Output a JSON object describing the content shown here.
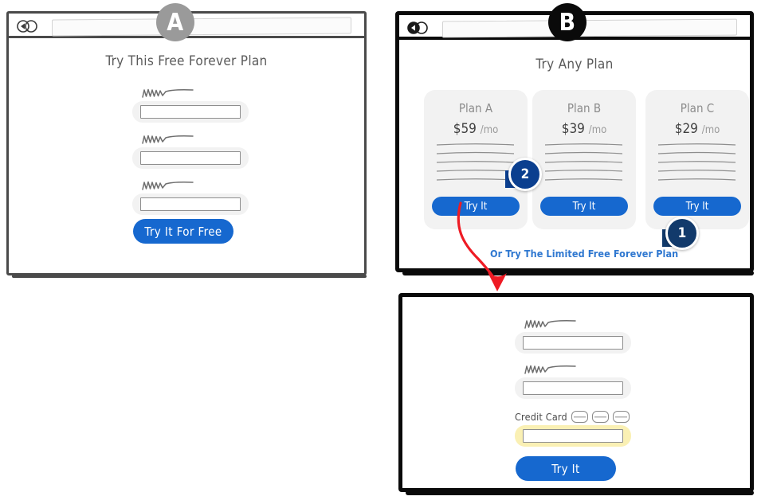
{
  "panel_a": {
    "marker_label": "A",
    "marker_color": "#9a9a9a",
    "browser": {
      "back_icon": "back-arrow-icon",
      "forward_icon": "forward-circle-icon",
      "url_value": ""
    },
    "title": "Try This Free Forever Plan",
    "fields": [
      {
        "label_icon": "scribble-label",
        "value": "",
        "placeholder": ""
      },
      {
        "label_icon": "scribble-label",
        "value": "",
        "placeholder": ""
      },
      {
        "label_icon": "scribble-label",
        "value": "",
        "placeholder": ""
      }
    ],
    "submit_label": "Try It For Free",
    "submit_color": "#1668cf"
  },
  "panel_b": {
    "marker_label": "B",
    "marker_color": "#0a0a0a",
    "browser": {
      "back_icon": "back-arrow-icon",
      "forward_icon": "forward-circle-icon",
      "url_value": ""
    },
    "title": "Try Any Plan",
    "plans": [
      {
        "name": "Plan A",
        "price": "$59",
        "period": "/mo",
        "feature_line_count": 5,
        "cta_label": "Try It"
      },
      {
        "name": "Plan B",
        "price": "$39",
        "period": "/mo",
        "feature_line_count": 5,
        "cta_label": "Try It"
      },
      {
        "name": "Plan C",
        "price": "$29",
        "period": "/mo",
        "feature_line_count": 5,
        "cta_label": "Try It"
      }
    ],
    "free_plan_link": "Or Try The Limited Free Forever Plan",
    "free_plan_link_color": "#2e77d0",
    "cta_color": "#1668cf",
    "badges": [
      {
        "number": "1",
        "color": "#123a6b"
      },
      {
        "number": "2",
        "color": "#0b3f8f"
      }
    ]
  },
  "panel_c": {
    "fields": [
      {
        "label_icon": "scribble-label",
        "value": "",
        "placeholder": "",
        "highlight": false
      },
      {
        "label_icon": "scribble-label",
        "value": "",
        "placeholder": "",
        "highlight": false
      }
    ],
    "credit_card_label": "Credit Card",
    "credit_card_icons": [
      "card-icon",
      "card-icon",
      "card-icon"
    ],
    "credit_card_value": "",
    "credit_card_highlight_color": "#faf0b4",
    "submit_label": "Try It",
    "submit_color": "#1668cf"
  },
  "annotation": {
    "arrow_color": "#ee1b24",
    "arrow_name": "flow-arrow-try-it-to-checkout"
  }
}
